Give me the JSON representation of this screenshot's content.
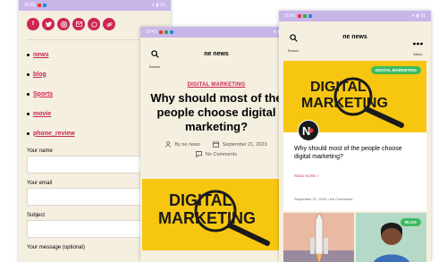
{
  "statusbar": {
    "left_time": "10:41",
    "mid_time": "10:41",
    "right_time": "10:41",
    "battery": "61"
  },
  "colors": {
    "accent": "#cd2653",
    "page_bg": "#f5efe0",
    "status_bar": "#c9b6e9",
    "yellow": "#f7c611",
    "badge_green": "#3dbb60"
  },
  "left_phone": {
    "social_icons": [
      "facebook-icon",
      "twitter-icon",
      "instagram-icon",
      "email-icon",
      "whatsapp-icon",
      "link-icon"
    ],
    "menu_items": [
      "news",
      "blog",
      "Sports",
      "movie",
      "phone_review"
    ],
    "form": {
      "name_label": "Your name",
      "email_label": "Your email",
      "subject_label": "Subject",
      "message_label": "Your message (optional)"
    }
  },
  "middle_phone": {
    "search_label": "Search",
    "site_title": "ne news",
    "category": "DIGITAL MARKETING",
    "headline": "Why should most of the people choose digital marketing?",
    "author": "By ne news",
    "date": "September 21, 2023",
    "comments": "No Comments",
    "image_text_line1": "DIGITAL",
    "image_text_line2": "MARKETING"
  },
  "right_phone": {
    "search_label": "Search",
    "site_title": "ne news",
    "menu_label": "Menu",
    "card": {
      "badge": "DIGITAL MARKETING",
      "image_text_line1": "DIGITAL",
      "image_text_line2": "MARKETING",
      "title": "Why should most of the people choose digital marketing?",
      "read_more": "READ MORE »",
      "meta": "September 21, 2023  •  No Comments"
    },
    "second_badge": "BLOG"
  }
}
